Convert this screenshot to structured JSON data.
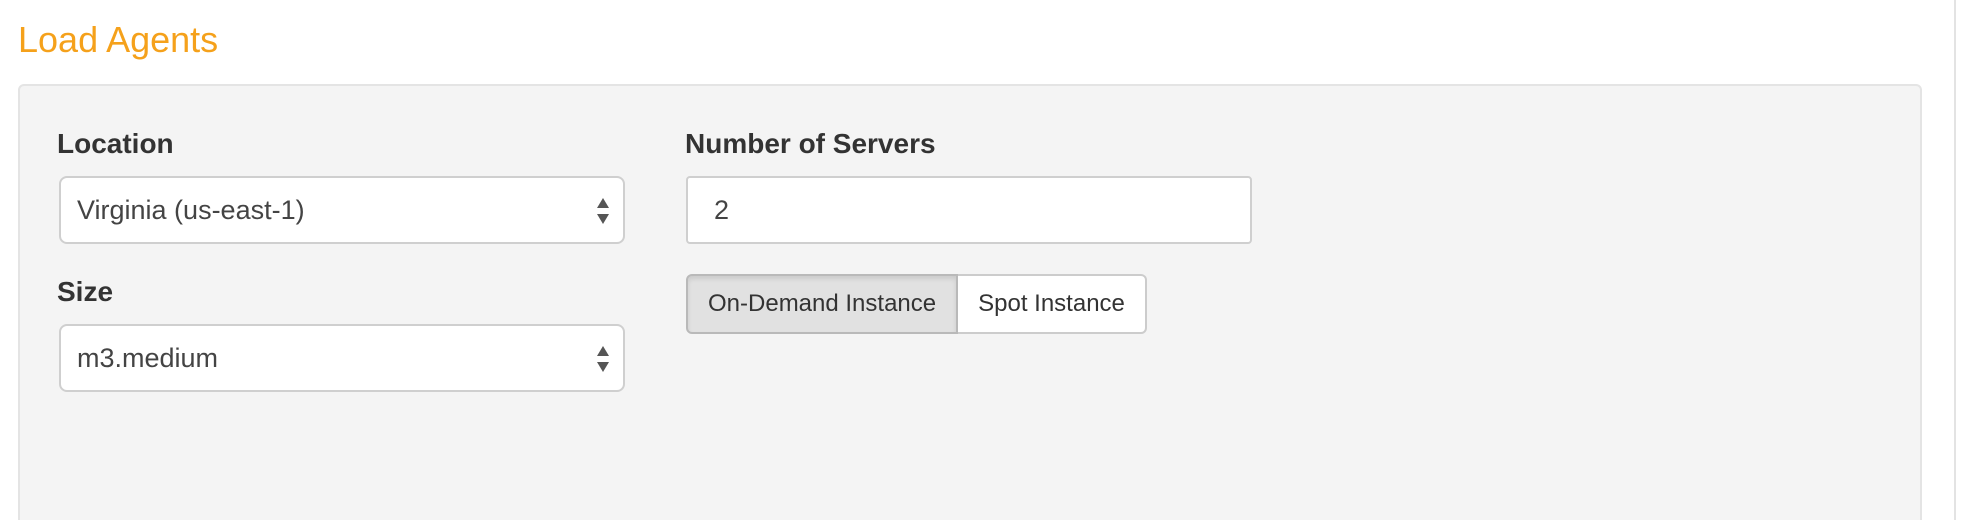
{
  "section": {
    "title": "Load Agents"
  },
  "form": {
    "location": {
      "label": "Location",
      "value": "Virginia (us-east-1)"
    },
    "size": {
      "label": "Size",
      "value": "m3.medium"
    },
    "servers": {
      "label": "Number of Servers",
      "value": "2"
    },
    "instance_type": {
      "options": [
        "On-Demand Instance",
        "Spot Instance"
      ],
      "selected": "On-Demand Instance"
    }
  },
  "colors": {
    "accent": "#f5a11b",
    "panel_background": "#f4f4f4",
    "active_button": "#e1e1e1"
  },
  "icons": {
    "select_arrows": "up-down-arrows-icon"
  }
}
